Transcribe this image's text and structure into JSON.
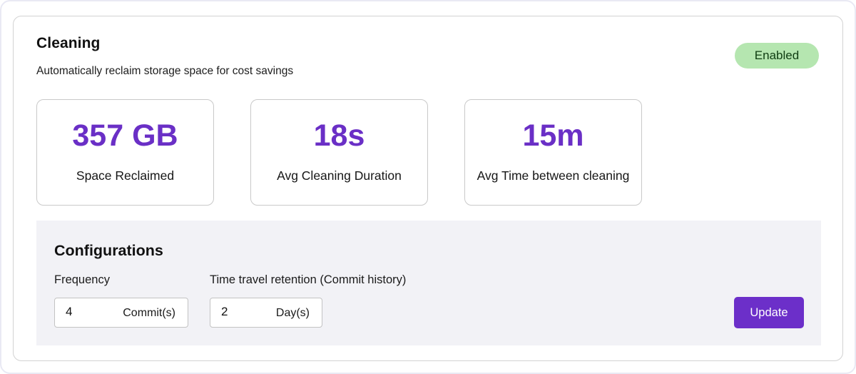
{
  "header": {
    "title": "Cleaning",
    "subtitle": "Automatically reclaim storage space for cost savings",
    "status_badge": "Enabled"
  },
  "colors": {
    "accent": "#6a2fc6",
    "badge_bg": "#b5e6b0",
    "badge_text": "#0f3d12",
    "config_bg": "#f2f2f6"
  },
  "stats": [
    {
      "value": "357 GB",
      "label": "Space Reclaimed"
    },
    {
      "value": "18s",
      "label": "Avg Cleaning Duration"
    },
    {
      "value": "15m",
      "label": "Avg Time between cleaning"
    }
  ],
  "config": {
    "title": "Configurations",
    "frequency": {
      "label": "Frequency",
      "value": "4",
      "unit": "Commit(s)"
    },
    "retention": {
      "label": "Time travel retention (Commit history)",
      "value": "2",
      "unit": "Day(s)"
    },
    "update_label": "Update"
  }
}
